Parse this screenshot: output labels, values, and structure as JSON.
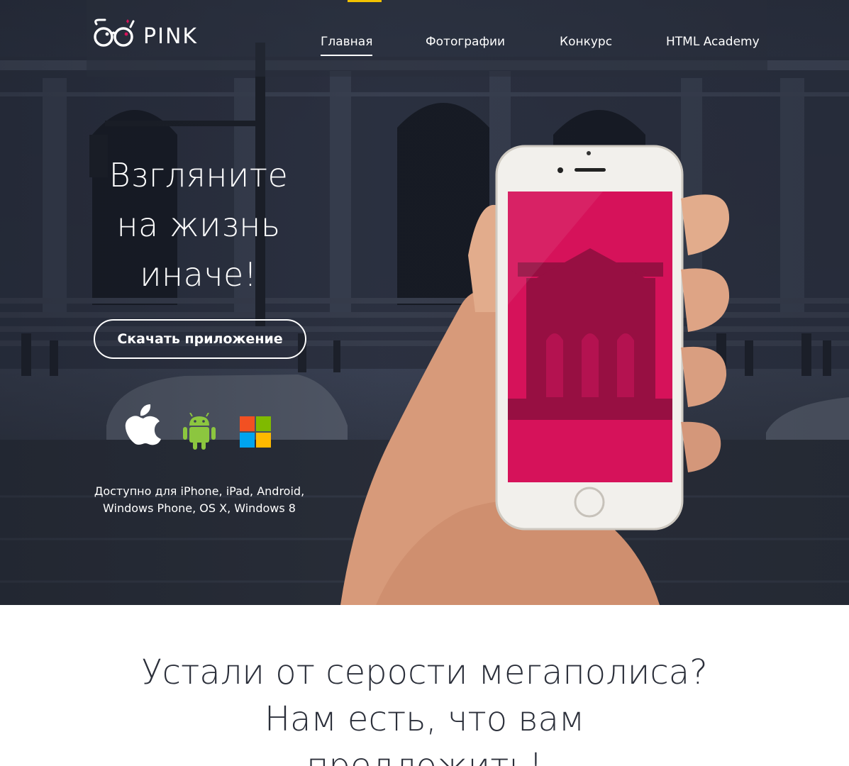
{
  "logo": {
    "text": "PINK"
  },
  "nav": {
    "items": [
      {
        "label": "Главная",
        "active": true
      },
      {
        "label": "Фотографии",
        "active": false
      },
      {
        "label": "Конкурс",
        "active": false
      },
      {
        "label": "HTML Academy",
        "active": false
      }
    ]
  },
  "hero": {
    "headline_lines": [
      "Взгляните",
      "на жизнь",
      "иначе!"
    ],
    "download_button": "Скачать приложение",
    "platforms": [
      {
        "icon": "apple-icon"
      },
      {
        "icon": "android-icon"
      },
      {
        "icon": "windows-icon"
      }
    ],
    "availability_lines": [
      "Доступно для iPhone, iPad, Android,",
      "Windows Phone, OS X, Windows 8"
    ]
  },
  "lower": {
    "title_lines": [
      "Устали от серости мегаполиса?",
      "Нам есть, что вам",
      "предложить!"
    ]
  },
  "colors": {
    "accent_yellow": "#f2c200",
    "screen_pink": "#d6125a",
    "android_green": "#8cc63f"
  }
}
